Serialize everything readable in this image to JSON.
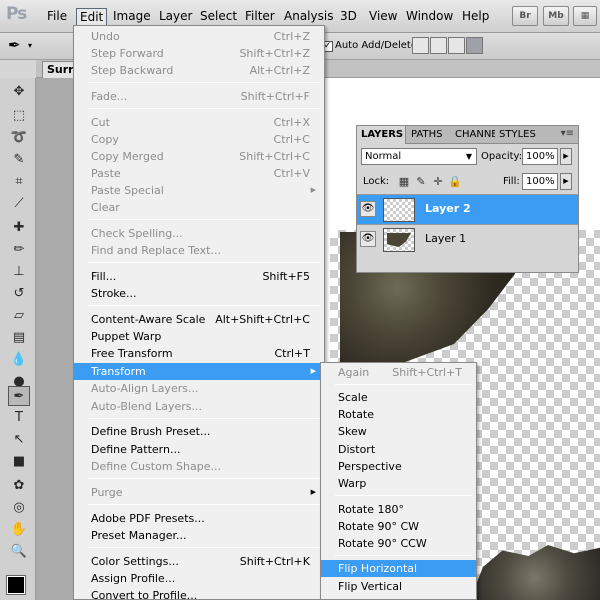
{
  "app": {
    "logo": "Ps"
  },
  "menubar": {
    "items": [
      "File",
      "Edit",
      "Image",
      "Layer",
      "Select",
      "Filter",
      "Analysis",
      "3D",
      "View",
      "Window",
      "Help"
    ],
    "bridge_label": "Br",
    "minibridge_label": "Mb"
  },
  "options": {
    "auto_add_delete_label": "Auto Add/Delete",
    "auto_add_delete_checked": true
  },
  "document": {
    "tab_title": "Surrea"
  },
  "layers_panel": {
    "tabs": [
      "LAYERS",
      "PATHS",
      "CHANNE",
      "STYLES"
    ],
    "menu_glyph": "▾≡",
    "blend_mode": "Normal",
    "opacity_label": "Opacity:",
    "opacity_value": "100%",
    "lock_label": "Lock:",
    "fill_label": "Fill:",
    "fill_value": "100%",
    "layers": [
      {
        "name": "Layer 2",
        "selected": true
      },
      {
        "name": "Layer 1",
        "selected": false
      }
    ]
  },
  "edit_menu": {
    "items": [
      {
        "label": "Undo",
        "shortcut": "Ctrl+Z",
        "disabled": true
      },
      {
        "label": "Step Forward",
        "shortcut": "Shift+Ctrl+Z",
        "disabled": true
      },
      {
        "label": "Step Backward",
        "shortcut": "Alt+Ctrl+Z",
        "disabled": true
      },
      {
        "label": "Fade...",
        "shortcut": "Shift+Ctrl+F",
        "disabled": true
      },
      {
        "label": "Cut",
        "shortcut": "Ctrl+X",
        "disabled": true
      },
      {
        "label": "Copy",
        "shortcut": "Ctrl+C",
        "disabled": true
      },
      {
        "label": "Copy Merged",
        "shortcut": "Shift+Ctrl+C",
        "disabled": true
      },
      {
        "label": "Paste",
        "shortcut": "Ctrl+V",
        "disabled": true
      },
      {
        "label": "Paste Special",
        "shortcut": "",
        "disabled": true,
        "submenu": true
      },
      {
        "label": "Clear",
        "shortcut": "",
        "disabled": true
      },
      {
        "label": "Check Spelling...",
        "shortcut": "",
        "disabled": true
      },
      {
        "label": "Find and Replace Text...",
        "shortcut": "",
        "disabled": true
      },
      {
        "label": "Fill...",
        "shortcut": "Shift+F5",
        "disabled": false
      },
      {
        "label": "Stroke...",
        "shortcut": "",
        "disabled": false
      },
      {
        "label": "Content-Aware Scale",
        "shortcut": "Alt+Shift+Ctrl+C",
        "disabled": false
      },
      {
        "label": "Puppet Warp",
        "shortcut": "",
        "disabled": false
      },
      {
        "label": "Free Transform",
        "shortcut": "Ctrl+T",
        "disabled": false
      },
      {
        "label": "Transform",
        "shortcut": "",
        "disabled": false,
        "submenu": true,
        "highlight": true
      },
      {
        "label": "Auto-Align Layers...",
        "shortcut": "",
        "disabled": true
      },
      {
        "label": "Auto-Blend Layers...",
        "shortcut": "",
        "disabled": true
      },
      {
        "label": "Define Brush Preset...",
        "shortcut": "",
        "disabled": false
      },
      {
        "label": "Define Pattern...",
        "shortcut": "",
        "disabled": false
      },
      {
        "label": "Define Custom Shape...",
        "shortcut": "",
        "disabled": true
      },
      {
        "label": "Purge",
        "shortcut": "",
        "disabled": false,
        "submenu": true
      },
      {
        "label": "Adobe PDF Presets...",
        "shortcut": "",
        "disabled": false
      },
      {
        "label": "Preset Manager...",
        "shortcut": "",
        "disabled": false
      },
      {
        "label": "Color Settings...",
        "shortcut": "Shift+Ctrl+K",
        "disabled": false
      },
      {
        "label": "Assign Profile...",
        "shortcut": "",
        "disabled": false
      },
      {
        "label": "Convert to Profile...",
        "shortcut": "",
        "disabled": false
      }
    ]
  },
  "transform_submenu": {
    "items": [
      {
        "label": "Again",
        "shortcut": "Shift+Ctrl+T",
        "disabled": true
      },
      {
        "label": "Scale",
        "shortcut": "",
        "disabled": false
      },
      {
        "label": "Rotate",
        "shortcut": "",
        "disabled": false
      },
      {
        "label": "Skew",
        "shortcut": "",
        "disabled": false
      },
      {
        "label": "Distort",
        "shortcut": "",
        "disabled": false
      },
      {
        "label": "Perspective",
        "shortcut": "",
        "disabled": false
      },
      {
        "label": "Warp",
        "shortcut": "",
        "disabled": false
      },
      {
        "label": "Rotate 180°",
        "shortcut": "",
        "disabled": false
      },
      {
        "label": "Rotate 90° CW",
        "shortcut": "",
        "disabled": false
      },
      {
        "label": "Rotate 90° CCW",
        "shortcut": "",
        "disabled": false
      },
      {
        "label": "Flip Horizontal",
        "shortcut": "",
        "disabled": false,
        "highlight": true
      },
      {
        "label": "Flip Vertical",
        "shortcut": "",
        "disabled": false
      }
    ]
  },
  "colors": {
    "highlight": "#3b9cf4",
    "foreground": "#000000"
  }
}
